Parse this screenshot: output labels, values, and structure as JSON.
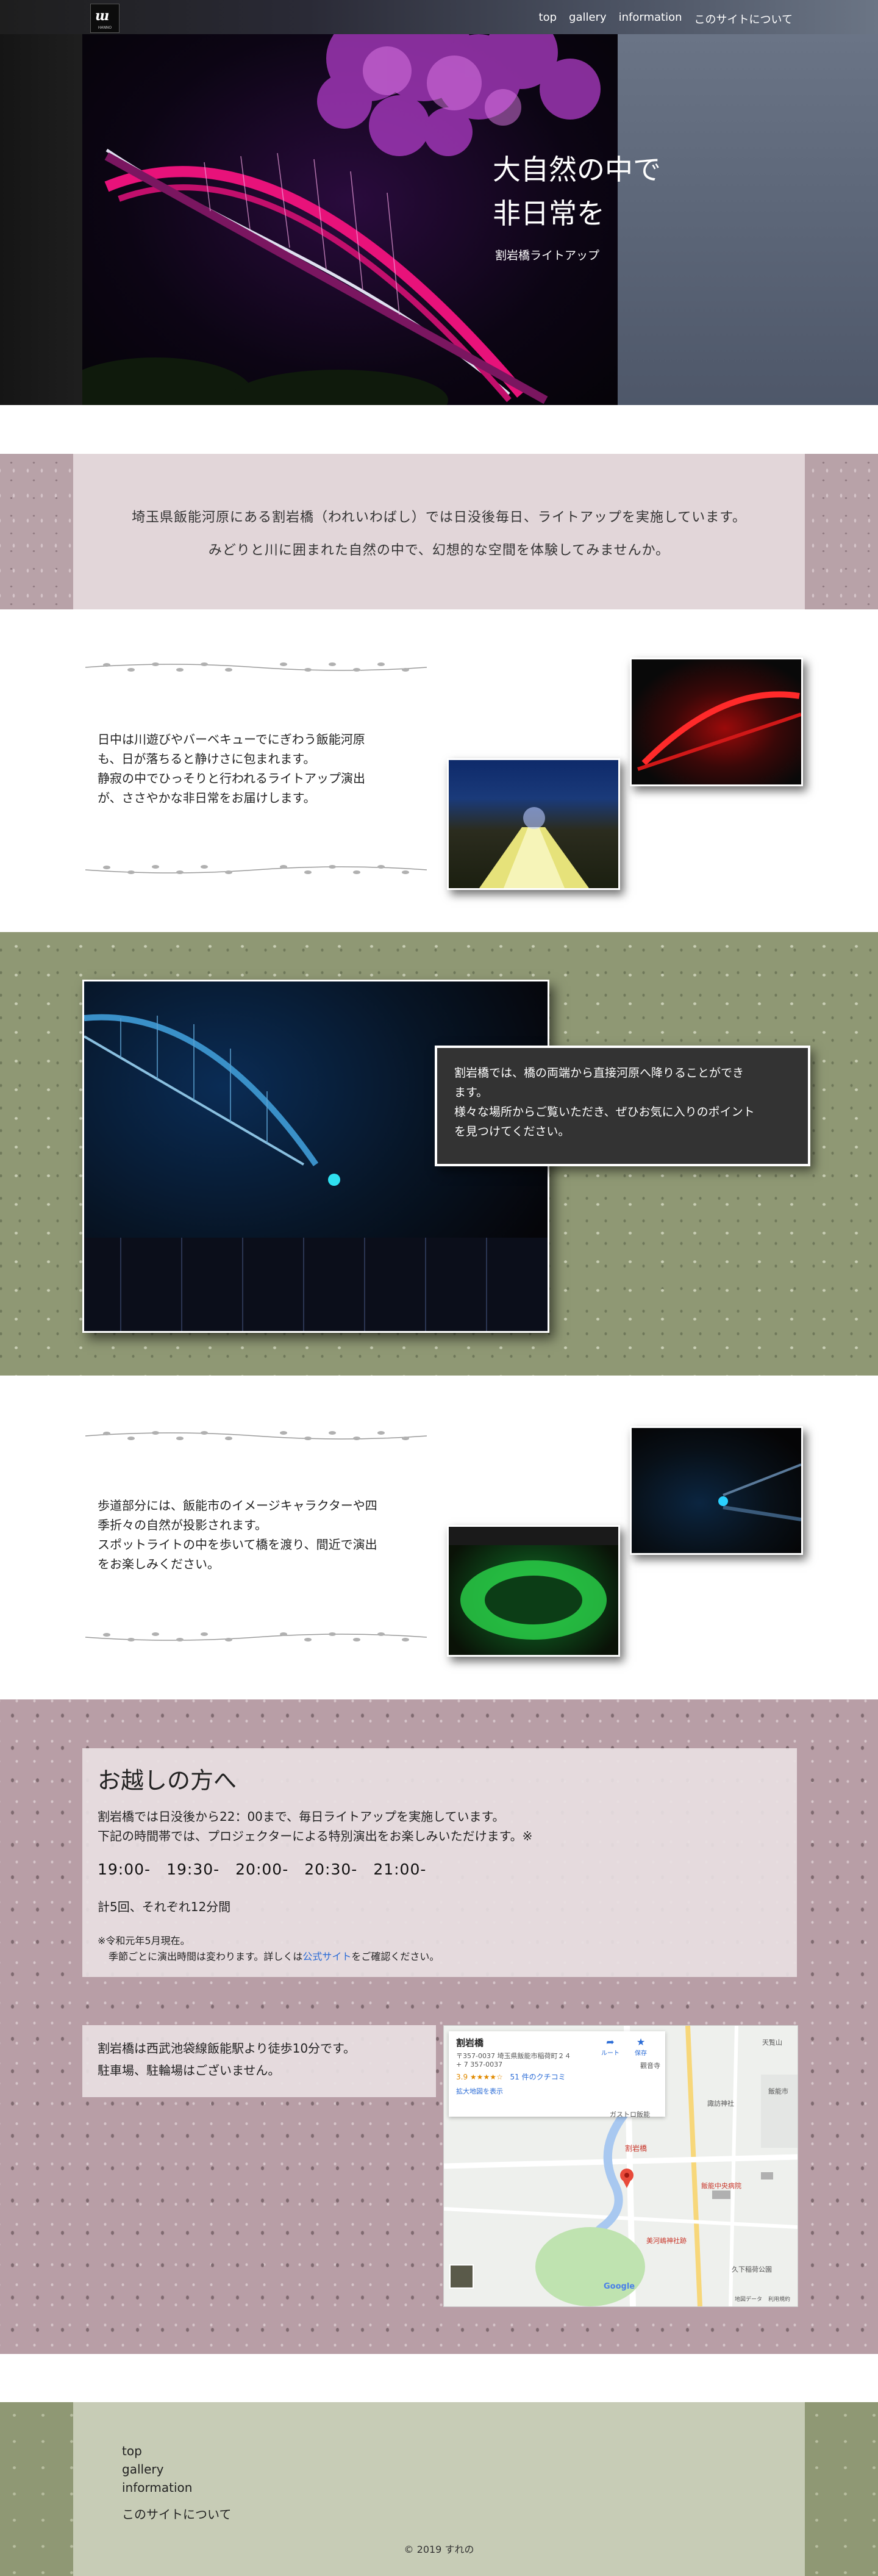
{
  "header": {
    "logo_mark": "ɯ",
    "logo_sub": "HANNO",
    "nav": [
      "top",
      "gallery",
      "information",
      "このサイトについて"
    ]
  },
  "hero": {
    "title_line1": "大自然の中で",
    "title_line2": "非日常を",
    "subtitle": "割岩橋ライトアップ"
  },
  "intro": {
    "line1": "埼玉県飯能河原にある割岩橋（われいわばし）では日没後毎日、ライトアップを実施しています。",
    "line2": "みどりと川に囲まれた自然の中で、幻想的な空間を体験してみませんか。"
  },
  "section1": {
    "lines": [
      "日中は川遊びやバーベキューでにぎわう飯能河原",
      "も、日が落ちると静けさに包まれます。",
      "静寂の中でひっそりと行われるライトアップ演出",
      "が、ささやかな非日常をお届けします。"
    ]
  },
  "section2": {
    "lines": [
      "割岩橋では、橋の両端から直接河原へ降りることができ",
      "ます。",
      "様々な場所からご覧いただき、ぜひお気に入りのポイント",
      "を見つけてください。"
    ]
  },
  "section3": {
    "lines": [
      "歩道部分には、飯能市のイメージキャラクターや四",
      "季折々の自然が投影されます。",
      "スポットライトの中を歩いて橋を渡り、間近で演出",
      "をお楽しみください。"
    ]
  },
  "access": {
    "title": "お越しの方へ",
    "p1": "割岩橋では日没後から22：00まで、毎日ライトアップを実施しています。",
    "p2": "下記の時間帯では、プロジェクターによる特別演出をお楽しみいただけます。※",
    "times": [
      "19:00-",
      "19:30-",
      "20:00-",
      "20:30-",
      "21:00-"
    ],
    "total": "計5回、それぞれ12分間",
    "note1": "※令和元年5月現在。",
    "note2_pre": "季節ごとに演出時間は変わります。詳しくは",
    "note2_link": "公式サイト",
    "note2_post": "をご確認ください。",
    "station_line1": "割岩橋は西武池袋線飯能駅より徒歩10分です。",
    "station_line2": "駐車場、駐輪場はございません。"
  },
  "map": {
    "place_name": "割岩橋",
    "address": "〒357-0037 埼玉県飯能市稲荷町２４",
    "plus": "+ 7 357-0037",
    "rating": "3.9",
    "stars": "★★★★☆",
    "reviews": "51 件のクチコミ",
    "expand_link": "拡大地図を表示",
    "route_label": "ルート",
    "save_label": "保存",
    "pin_label": "割岩橋",
    "labels": [
      "觀音寺",
      "天覧山",
      "飯能中央病院",
      "久下稲荷公園",
      "美河嶋神社跡",
      "ガストロ飯能",
      "飯能市",
      "諏訪神社"
    ],
    "google": "Google",
    "map_data": "地図データ",
    "terms": "利用規約"
  },
  "footer": {
    "links": [
      "top",
      "gallery",
      "information",
      "このサイトについて"
    ],
    "copyright": "© 2019 すれの"
  },
  "colors": {
    "pink_band": "#b8a2a8",
    "green_band": "#8f9874",
    "link_blue": "#2a6bd6",
    "note_bg": "#333333"
  }
}
